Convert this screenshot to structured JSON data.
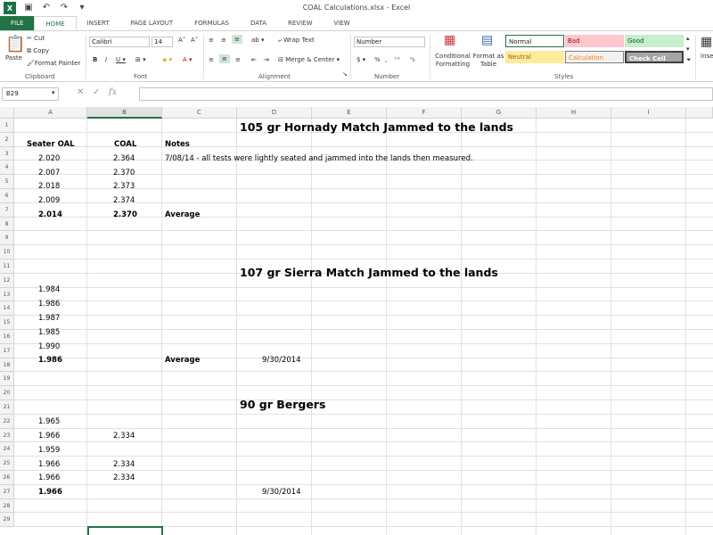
{
  "window": {
    "title": "COAL Calculations.xlsx - Excel",
    "logo": "X"
  },
  "tabs": [
    "FILE",
    "HOME",
    "INSERT",
    "PAGE LAYOUT",
    "FORMULAS",
    "DATA",
    "REVIEW",
    "VIEW"
  ],
  "ribbon": {
    "clipboard": {
      "paste": "Paste",
      "cut": "Cut",
      "copy": "Copy",
      "format_painter": "Format Painter",
      "label": "Clipboard"
    },
    "font": {
      "name": "Calibri",
      "size": "14",
      "label": "Font"
    },
    "alignment": {
      "wrap": "Wrap Text",
      "merge": "Merge & Center",
      "label": "Alignment"
    },
    "number": {
      "format": "Number",
      "label": "Number"
    },
    "styles": {
      "conditional": "Conditional Formatting",
      "format_table": "Format as Table",
      "normal": "Normal",
      "bad": "Bad",
      "good": "Good",
      "neutral": "Neutral",
      "calculation": "Calculation",
      "check_cell": "Check Cell",
      "label": "Styles"
    },
    "insert_partial": "Inse"
  },
  "formula_bar": {
    "namebox": "B29",
    "fx": "fx",
    "value": ""
  },
  "columns": [
    "A",
    "B",
    "C",
    "D",
    "E",
    "F",
    "G",
    "H",
    "I"
  ],
  "rows": [
    "1",
    "2",
    "3",
    "4",
    "5",
    "6",
    "7",
    "8",
    "9",
    "10",
    "11",
    "12",
    "13",
    "14",
    "15",
    "16",
    "17",
    "18",
    "19",
    "20",
    "21",
    "22",
    "23",
    "24",
    "25",
    "26",
    "27",
    "28",
    "29"
  ],
  "cells": {
    "d1": "105 gr Hornady Match Jammed to the lands",
    "a2": "Seater OAL",
    "b2": "COAL",
    "c2": "Notes",
    "a3": "2.020",
    "b3": "2.364",
    "c3": "7/08/14 - all tests were lightly seated and jammed into the lands then measured.",
    "a4": "2.007",
    "b4": "2.370",
    "a5": "2.018",
    "b5": "2.373",
    "a6": "2.009",
    "b6": "2.374",
    "a7": "2.014",
    "b7": "2.370",
    "c7": "Average",
    "d11": "107 gr Sierra Match Jammed to the lands",
    "a12": "1.984",
    "a13": "1.986",
    "a14": "1.987",
    "a15": "1.985",
    "a16": "1.990",
    "a17": "1.986",
    "c17": "Average",
    "d17": "9/30/2014",
    "d20": "90 gr Bergers",
    "a21": "1.965",
    "a22": "1.966",
    "b22": "2.334",
    "a23": "1.959",
    "a24": "1.966",
    "b24": "2.334",
    "a25": "1.966",
    "b25": "2.334",
    "a26": "1.966",
    "d26": "9/30/2014"
  }
}
